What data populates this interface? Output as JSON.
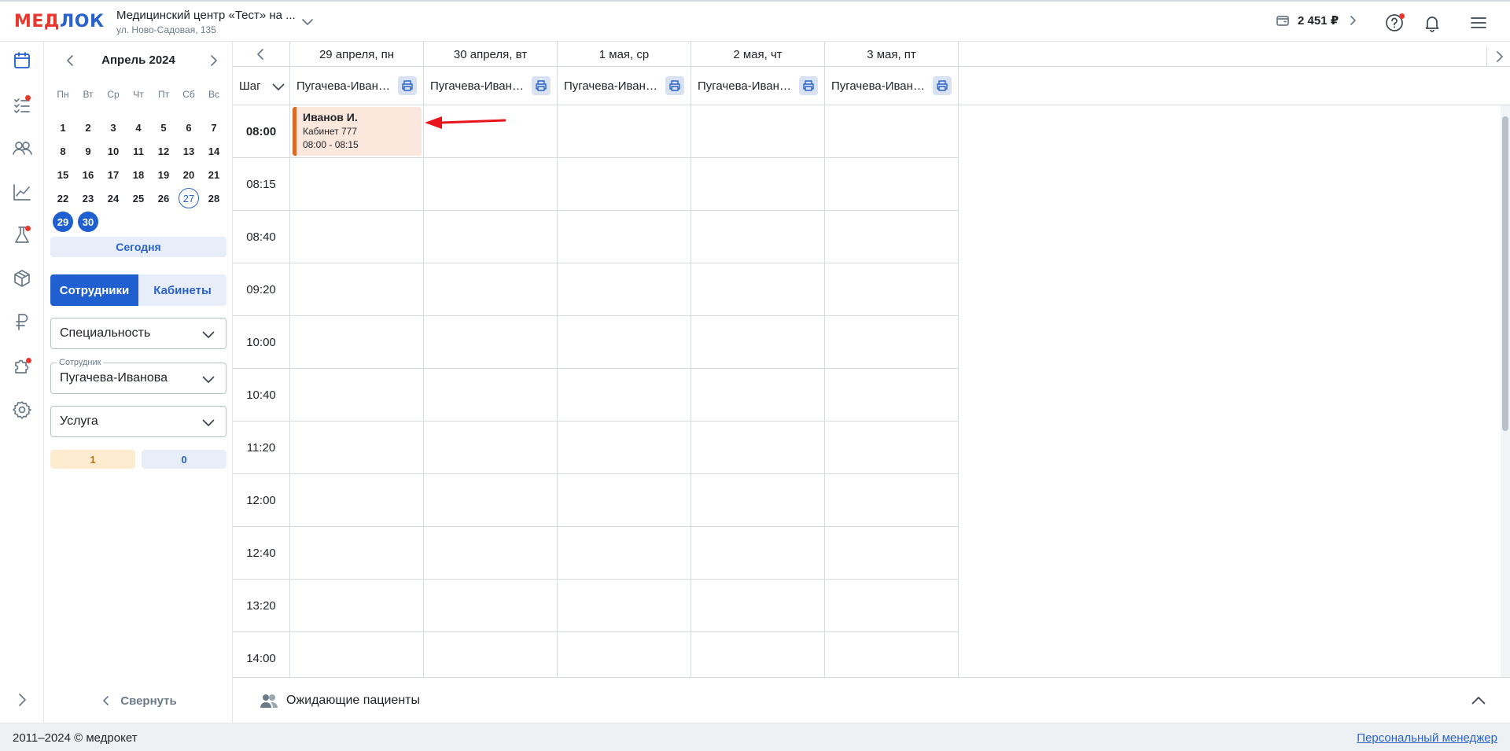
{
  "header": {
    "logo_text": "МЕДЛОК",
    "org_name": "Медицинский центр «Тест» на ...",
    "org_address": "ул. Ново-Садовая, 135",
    "balance": "2 451 ₽",
    "icons": [
      "wallet-icon",
      "chevron-right-icon",
      "help-icon",
      "bell-icon",
      "menu-icon"
    ]
  },
  "sidebar": {
    "items": [
      "calendar-icon",
      "tasks-icon",
      "patients-icon",
      "analytics-icon",
      "lab-icon",
      "warehouse-icon",
      "ruble-icon",
      "puzzle-icon",
      "settings-icon"
    ]
  },
  "calendar": {
    "title": "Апрель 2024",
    "weekdays": [
      "Пн",
      "Вт",
      "Ср",
      "Чт",
      "Пт",
      "Сб",
      "Вс"
    ],
    "days": [
      "1",
      "2",
      "3",
      "4",
      "5",
      "6",
      "7",
      "8",
      "9",
      "10",
      "11",
      "12",
      "13",
      "14",
      "15",
      "16",
      "17",
      "18",
      "19",
      "20",
      "21",
      "22",
      "23",
      "24",
      "25",
      "26",
      "27",
      "28",
      "29",
      "30"
    ],
    "today": "27",
    "selected": [
      "29",
      "30"
    ],
    "today_button": "Сегодня"
  },
  "filters": {
    "tab_employees": "Сотрудники",
    "tab_rooms": "Кабинеты",
    "specialty": "Специальность",
    "employee_label": "Сотрудник",
    "employee_value": "Пугачева-Иванова",
    "service": "Услуга",
    "count_booked": "1",
    "count_free": "0",
    "collapse": "Свернуть"
  },
  "schedule": {
    "step_label": "Шаг",
    "dates": [
      "29 апреля, пн",
      "30 апреля, вт",
      "1 мая, ср",
      "2 мая, чт",
      "3 мая, пт"
    ],
    "employees": [
      "Пугачева-Иванова",
      "Пугачева-Иванова",
      "Пугачева-Иванова",
      "Пугачева-Иванова",
      "Пугачева-Иванова"
    ],
    "times": [
      "08:00",
      "08:15",
      "08:40",
      "09:20",
      "10:00",
      "10:40",
      "11:20",
      "12:00",
      "12:40",
      "13:20",
      "14:00"
    ],
    "appointment": {
      "patient": "Иванов И.",
      "room": "Кабинет 777",
      "time": "08:00 - 08:15",
      "color": "#dd6a24"
    }
  },
  "waiting": {
    "label": "Ожидающие пациенты"
  },
  "footer": {
    "copyright": "2011–2024 © медрокет",
    "manager_link": "Персональный менеджер"
  }
}
